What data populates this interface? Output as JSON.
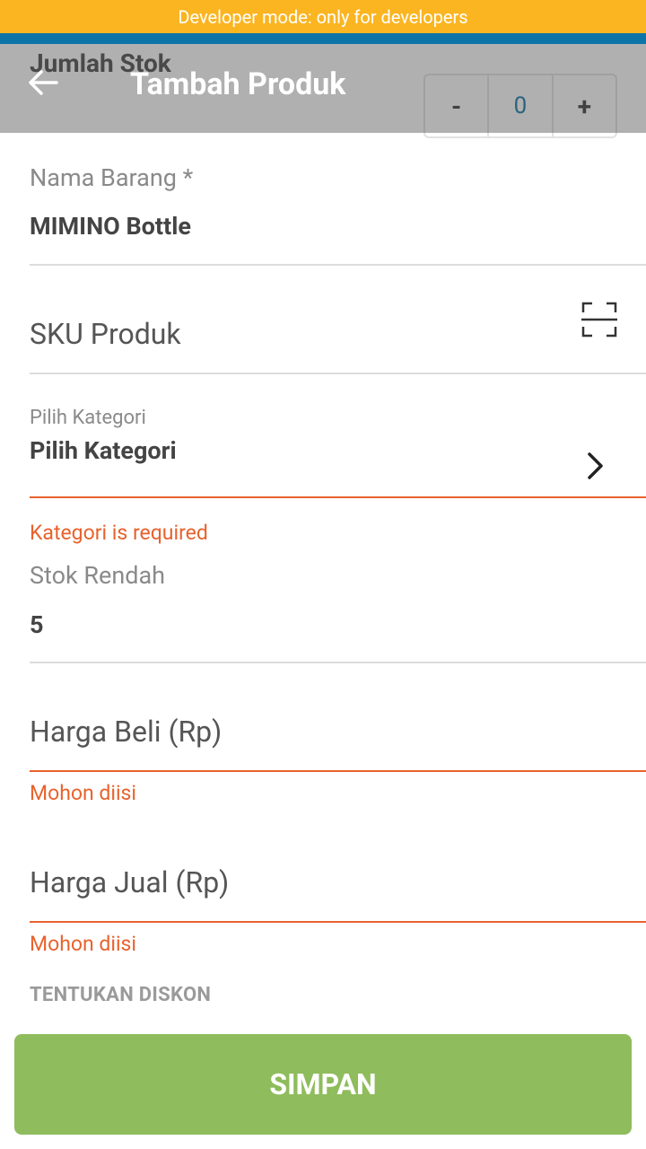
{
  "dev_banner": "Developer mode: only for developers",
  "header": {
    "title": "Tambah Produk",
    "back_icon": "arrow-left-icon"
  },
  "stock": {
    "label": "Jumlah Stok",
    "minus": "-",
    "value": "0",
    "plus": "+"
  },
  "form": {
    "nama_label": "Nama Barang *",
    "nama_value": "MIMINO Bottle",
    "sku_placeholder": "SKU Produk",
    "sku_icon": "barcode-scan-icon",
    "kategori_label": "Pilih Kategori",
    "kategori_value": "Pilih Kategori",
    "kategori_error": "Kategori is required",
    "stok_rendah_label": "Stok Rendah",
    "stok_rendah_value": "5",
    "harga_beli_placeholder": "Harga Beli (Rp)",
    "harga_beli_error": "Mohon diisi",
    "harga_jual_placeholder": "Harga Jual (Rp)",
    "harga_jual_error": "Mohon diisi",
    "diskon_header": "TENTUKAN DISKON"
  },
  "save_button": "SIMPAN",
  "colors": {
    "banner": "#fbb521",
    "primary_blue": "#0d74a8",
    "error": "#e8622d",
    "save_green": "#8fbc5c"
  }
}
